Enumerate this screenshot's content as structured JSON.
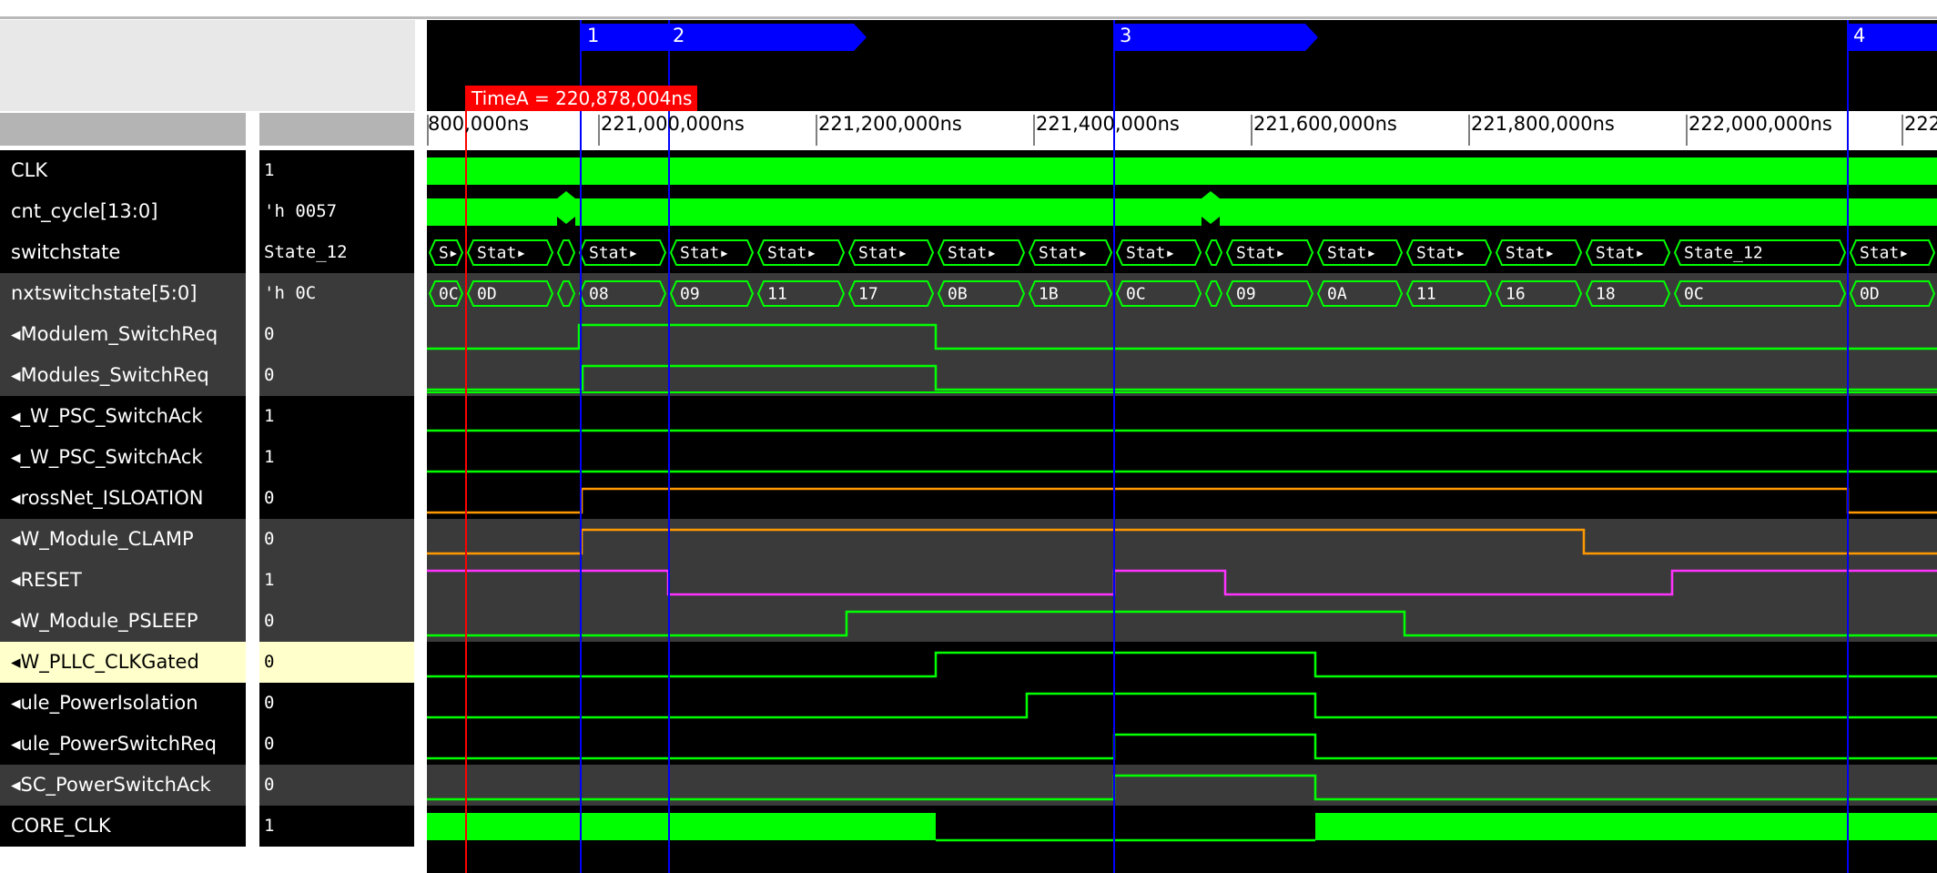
{
  "time_cursor": {
    "label": "TimeA = 220,878,004ns"
  },
  "timeline": {
    "ticks": [
      "800,000ns",
      "221,000,000ns",
      "221,200,000ns",
      "221,400,000ns",
      "221,600,000ns",
      "221,800,000ns",
      "222,000,000ns",
      "222"
    ]
  },
  "markers": [
    "1",
    "2",
    "3",
    "4"
  ],
  "colors": {
    "wave_green": "#00ff00",
    "orange": "#ff9900",
    "magenta": "#ff33ff",
    "cursor_red": "#ff0000",
    "marker_blue": "#0000ff",
    "highlight_row": "#ffffcc"
  },
  "signals": [
    {
      "name": "CLK",
      "value": "1"
    },
    {
      "name": "cnt_cycle[13:0]",
      "value": "'h 0057"
    },
    {
      "name": "switchstate",
      "value": "State_12"
    },
    {
      "name": "nxtswitchstate[5:0]",
      "value": "'h 0C"
    },
    {
      "name": "◂Modulem_SwitchReq",
      "value": "0"
    },
    {
      "name": "◂Modules_SwitchReq",
      "value": "0"
    },
    {
      "name": "◂_W_PSC_SwitchAck",
      "value": "1"
    },
    {
      "name": "◂_W_PSC_SwitchAck",
      "value": "1"
    },
    {
      "name": "◂rossNet_ISLOATION",
      "value": "0"
    },
    {
      "name": "◂W_Module_CLAMP",
      "value": "0"
    },
    {
      "name": "◂RESET",
      "value": "1"
    },
    {
      "name": "◂W_Module_PSLEEP",
      "value": "0"
    },
    {
      "name": "◂W_PLLC_CLKGated",
      "value": "0"
    },
    {
      "name": "◂ule_PowerIsolation",
      "value": "0"
    },
    {
      "name": "◂ule_PowerSwitchReq",
      "value": "0"
    },
    {
      "name": "◂SC_PowerSwitchAck",
      "value": "0"
    },
    {
      "name": "CORE_CLK",
      "value": "1"
    }
  ],
  "switchstate_segments": [
    "S▸",
    "Stat▸",
    "",
    "Stat▸",
    "Stat▸",
    "Stat▸",
    "Stat▸",
    "Stat▸",
    "Stat▸",
    "Stat▸",
    "",
    "Stat▸",
    "Stat▸",
    "Stat▸",
    "Stat▸",
    "Stat▸",
    "State_12",
    "Stat▸"
  ],
  "nxtswitchstate_segments": [
    "0C",
    "0D",
    "",
    "08",
    "09",
    "11",
    "17",
    "0B",
    "1B",
    "0C",
    "",
    "09",
    "0A",
    "11",
    "16",
    "18",
    "0C",
    "0D"
  ]
}
